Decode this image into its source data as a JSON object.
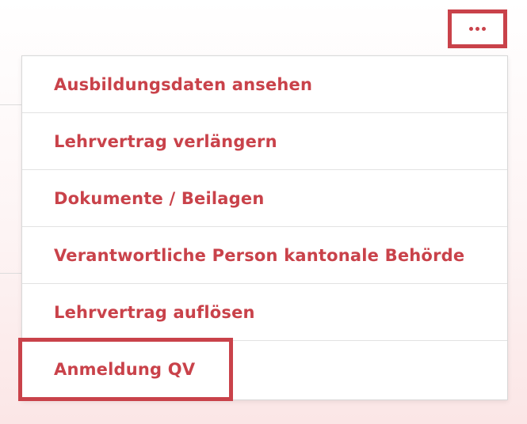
{
  "more_button": {
    "icon": "more-horizontal-icon",
    "accent_color": "#c9424a"
  },
  "menu": {
    "items": [
      {
        "label": "Ausbildungsdaten ansehen"
      },
      {
        "label": "Lehrvertrag verlängern"
      },
      {
        "label": "Dokumente / Beilagen"
      },
      {
        "label": "Verantwortliche Person kantonale Behörde"
      },
      {
        "label": "Lehrvertrag auflösen"
      },
      {
        "label": "Anmeldung QV"
      }
    ]
  }
}
